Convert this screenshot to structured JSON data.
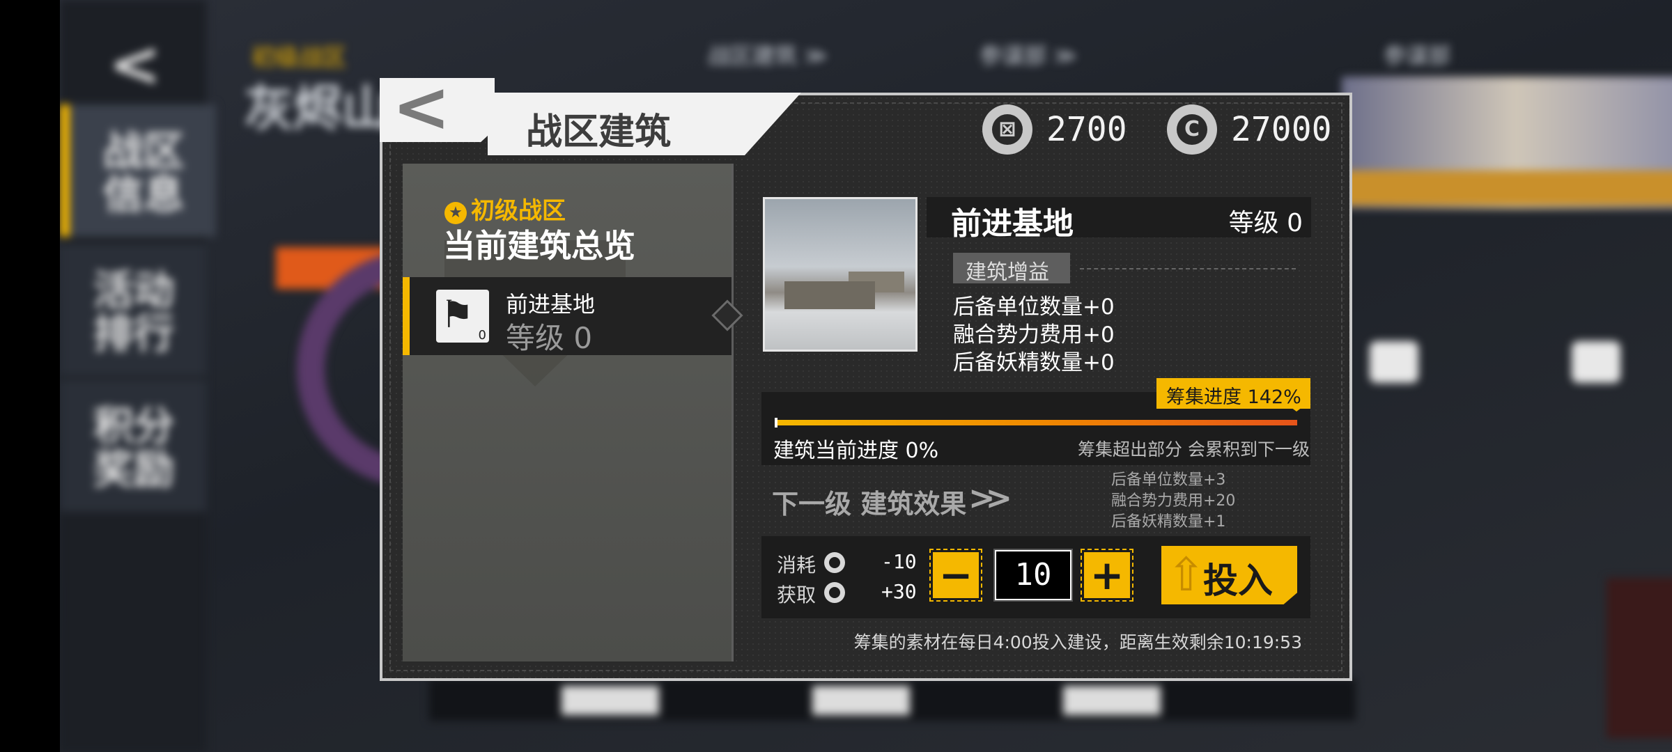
{
  "background": {
    "title": "灰烬山",
    "title_sub": "初级战区",
    "top_links": [
      "战区建筑 ≫",
      "参谋部 ≫",
      "参谋部"
    ],
    "left_tabs": [
      "战区信息",
      "活动排行",
      "积分奖励"
    ]
  },
  "dialog": {
    "title": "战区建筑",
    "currencies": [
      {
        "icon": "supply-icon",
        "amount": "2700"
      },
      {
        "icon": "credit-icon",
        "amount": "27000"
      }
    ]
  },
  "left_panel": {
    "zone_label": "初级战区",
    "overview_title": "当前建筑总览",
    "building": {
      "name": "前进基地",
      "level_text": "等级 0",
      "badge": "0"
    }
  },
  "detail": {
    "name": "前进基地",
    "level": "等级 0",
    "bonus_tag": "建筑增益",
    "bonuses": [
      "后备单位数量+0",
      "融合势力费用+0",
      "后备妖精数量+0"
    ],
    "progress_badge": "筹集进度 142%",
    "progress_fill": 1.0,
    "progress_text": "建筑当前进度 0%",
    "progress_note": "筹集超出部分 会累积到下一级",
    "next_level_label": "下一级 建筑效果",
    "next_effects": [
      "后备单位数量+3",
      "融合势力费用+20",
      "后备妖精数量+1"
    ]
  },
  "action": {
    "consume_label": "消耗",
    "consume_value": "-10",
    "gain_label": "获取",
    "gain_value": "+30",
    "minus": "−",
    "plus": "+",
    "quantity": "10",
    "invest_label": "投入",
    "footer_note": "筹集的素材在每日4:00投入建设，距离生效剩余10:19:53"
  },
  "colors": {
    "accent": "#f5b800",
    "panel": "#2a2a2a",
    "text": "#ffffff"
  }
}
